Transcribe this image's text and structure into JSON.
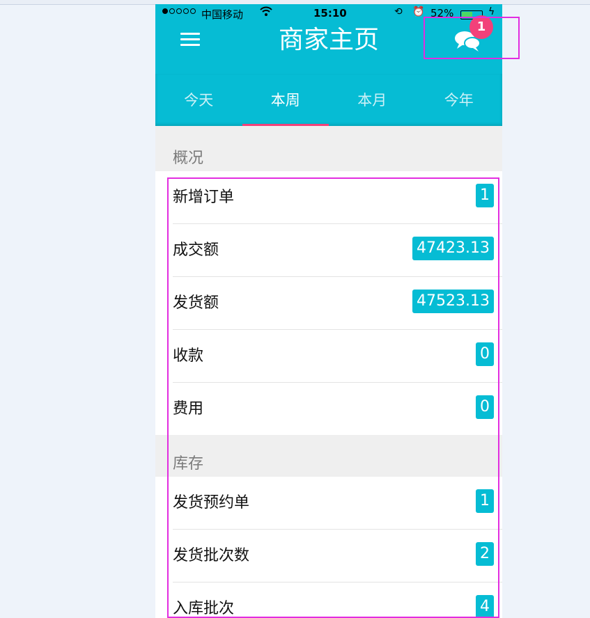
{
  "status_bar": {
    "carrier": "中国移动",
    "time": "15:10",
    "battery": "52%",
    "battery_level": 0.52
  },
  "header": {
    "title": "商家主页",
    "notification_count": "1"
  },
  "tabs": [
    {
      "label": "今天"
    },
    {
      "label": "本周"
    },
    {
      "label": "本月"
    },
    {
      "label": "今年"
    }
  ],
  "active_tab": "本周",
  "overview": {
    "title": "概况",
    "items": [
      {
        "label": "新增订单",
        "value": "1"
      },
      {
        "label": "成交额",
        "value": "47423.13"
      },
      {
        "label": "发货额",
        "value": "47523.13"
      },
      {
        "label": "收款",
        "value": "0"
      },
      {
        "label": "费用",
        "value": "0"
      }
    ]
  },
  "inventory": {
    "title": "库存",
    "items": [
      {
        "label": "发货预约单",
        "value": "1"
      },
      {
        "label": "发货批次数",
        "value": "2"
      },
      {
        "label": "入库批次",
        "value": "4"
      }
    ]
  },
  "colors": {
    "primary": "#06bcd4",
    "accent": "#f2417a",
    "highlight": "#e22de0"
  }
}
